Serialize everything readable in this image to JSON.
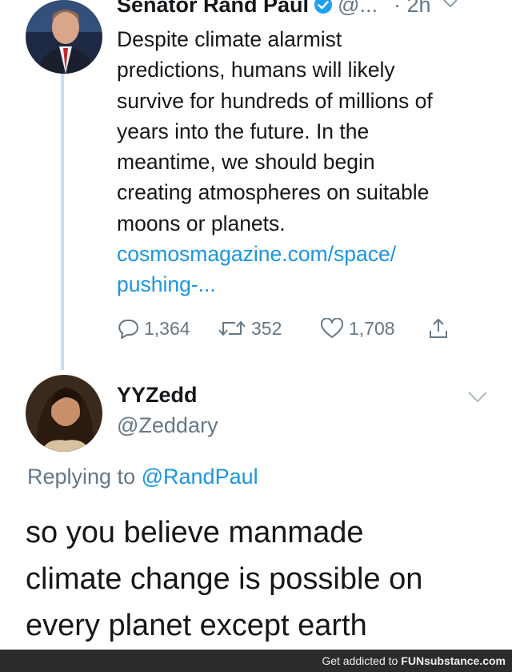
{
  "tweet1": {
    "author_name": "Senator Rand Paul",
    "handle": "@...",
    "time": "· 2h",
    "body_lines": [
      "Despite climate alarmist",
      "predictions, humans will likely",
      "survive for hundreds of millions of",
      "years into the future. In the",
      "meantime, we should begin",
      "creating atmospheres on suitable",
      "moons or planets."
    ],
    "link_lines": [
      "cosmosmagazine.com/space/",
      "pushing-..."
    ],
    "replies": "1,364",
    "retweets": "352",
    "likes": "1,708"
  },
  "tweet2": {
    "author_name": "YYZedd",
    "handle": "@Zeddary",
    "replying_prefix": "Replying to",
    "replying_mention": "@RandPaul",
    "body_lines": [
      "so you believe manmade",
      "climate change is possible on",
      "every planet except earth"
    ]
  },
  "footer": {
    "prefix": "Get addicted to",
    "brand": "FUNsubstance.com"
  },
  "colors": {
    "link": "#1b95e0",
    "muted": "#657786",
    "verified": "#1da1f2",
    "thread_line": "#c6e1f3"
  }
}
